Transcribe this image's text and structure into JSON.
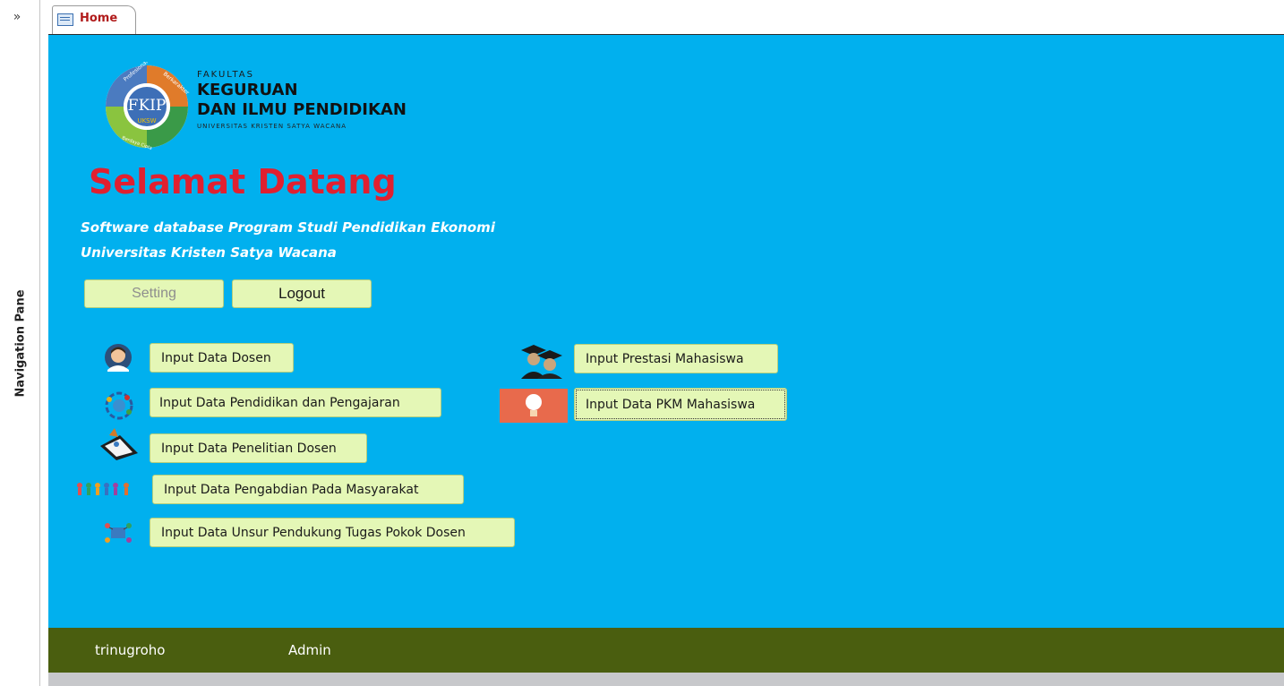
{
  "navigation_pane": {
    "toggle": "»",
    "label": "Navigation Pane"
  },
  "tab": {
    "label": "Home"
  },
  "logo": {
    "text": "FKIP",
    "ring_texts": [
      "Profesional",
      "Berkarakter",
      "UKSW",
      "Berdaya Cipta"
    ]
  },
  "faculty": {
    "line1": "FAKULTAS",
    "line2": "KEGURUAN",
    "line3": "DAN ILMU PENDIDIKAN",
    "line4": "UNIVERSITAS KRISTEN SATYA WACANA"
  },
  "welcome": "Selamat Datang",
  "subtitle": {
    "line1": "Software database Program Studi Pendidikan Ekonomi",
    "line2": "Universitas Kristen Satya Wacana"
  },
  "buttons": {
    "setting": "Setting",
    "logout": "Logout",
    "input_dosen": "Input Data Dosen",
    "input_pendidikan": "Input Data Pendidikan dan Pengajaran",
    "input_penelitian": "Input Data Penelitian Dosen",
    "input_pengabdian": "Input Data Pengabdian Pada Masyarakat",
    "input_unsur": "Input Data Unsur Pendukung Tugas Pokok Dosen",
    "input_prestasi": "Input Prestasi Mahasiswa",
    "input_pkm": "Input Data PKM Mahasiswa"
  },
  "footer": {
    "username": "trinugroho",
    "role": "Admin"
  },
  "colors": {
    "main_bg": "#01b0ee",
    "footer_bg": "#4a5e0f",
    "welcome": "#e02030",
    "button_bg": "#e4f7b6",
    "tab_label": "#b11b1b"
  },
  "icons": [
    "person-icon",
    "globe-icon",
    "research-icon",
    "community-icon",
    "support-icon",
    "graduates-icon",
    "lightbulb-icon",
    "form-icon"
  ]
}
